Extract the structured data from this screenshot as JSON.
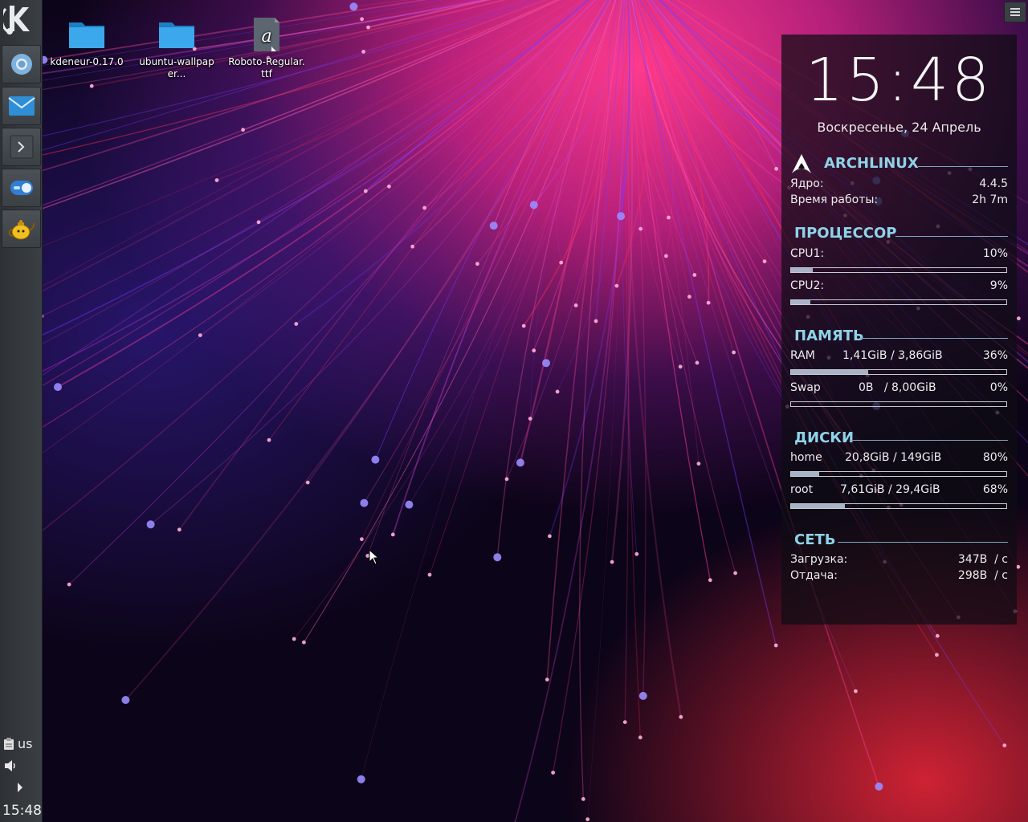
{
  "panel": {
    "launchers": [
      {
        "name": "chromium-icon",
        "color": "#8ec3ea"
      },
      {
        "name": "mail-icon",
        "color": "#2f8ed6"
      },
      {
        "name": "terminal-icon",
        "color": "#cfd3d6"
      },
      {
        "name": "toggle-settings-icon",
        "color": "#3a8fe0"
      },
      {
        "name": "teapot-icon",
        "color": "#f0c020"
      }
    ],
    "tray": {
      "keyboard_layout": "us",
      "clock": "15:48"
    }
  },
  "desktop": {
    "icons": [
      {
        "label": "kdeneur-0.17.0",
        "icon": "folder-icon"
      },
      {
        "label": "ubuntu-wallpaper...",
        "icon": "folder-icon"
      },
      {
        "label": "Roboto-Regular.ttf",
        "icon": "font-file-icon"
      }
    ]
  },
  "sysmon": {
    "time": "15:48",
    "date": "Воскресенье, 24 Апрель",
    "system": {
      "title": "ARCHLINUX",
      "kernel_label": "Ядро:",
      "kernel_value": "4.4.5",
      "uptime_label": "Время работы:",
      "uptime_value": "2h 7m"
    },
    "cpu": {
      "title": "ПРОЦЕССОР",
      "items": [
        {
          "label": "CPU1:",
          "value": "10%",
          "level": 10
        },
        {
          "label": "CPU2:",
          "value": "9%",
          "level": 9
        }
      ]
    },
    "memory": {
      "title": "ПАМЯТЬ",
      "items": [
        {
          "label": "RAM",
          "detail": "1,41GiB / 3,86GiB",
          "value": "36%",
          "level": 36
        },
        {
          "label": "Swap",
          "detail": "0B   / 8,00GiB",
          "value": "0%",
          "level": 0
        }
      ]
    },
    "disks": {
      "title": "ДИСКИ",
      "items": [
        {
          "label": "home",
          "detail": "20,8GiB / 149GiB",
          "value": "80%",
          "level": 13
        },
        {
          "label": "root",
          "detail": "7,61GiB / 29,4GiB",
          "value": "68%",
          "level": 25
        }
      ]
    },
    "network": {
      "title": "СЕТЬ",
      "download_label": "Загрузка:",
      "download_value": "347B  / c",
      "upload_label": "Отдача:",
      "upload_value": "298B  / c"
    }
  },
  "colors": {
    "accent": "#8fd3e8",
    "panel": "#363b40"
  }
}
